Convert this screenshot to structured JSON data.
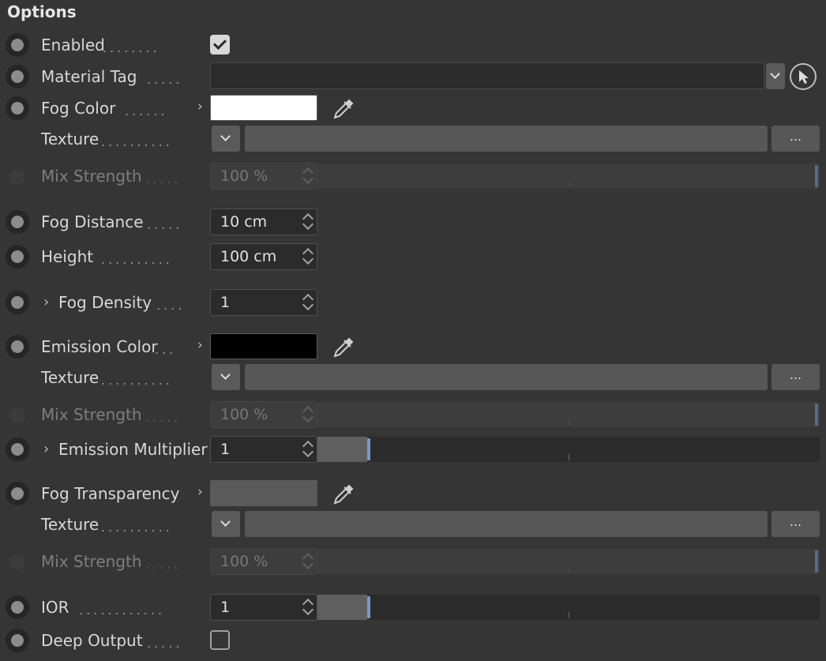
{
  "section": {
    "title": "Options"
  },
  "rows": {
    "enabled": {
      "label": "Enabled",
      "checked": true
    },
    "material_tag": {
      "label": "Material Tag",
      "value": ""
    },
    "fog_color": {
      "label": "Fog Color",
      "color": "#ffffff"
    },
    "fog_color_texture": {
      "label": "Texture",
      "more": "..."
    },
    "fog_color_mix": {
      "label": "Mix Strength",
      "value": "100 %",
      "level": 1.0
    },
    "fog_distance": {
      "label": "Fog Distance",
      "value": "10 cm"
    },
    "height": {
      "label": "Height",
      "value": "100 cm"
    },
    "fog_density": {
      "label": "Fog Density",
      "value": "1"
    },
    "emission_color": {
      "label": "Emission Color",
      "color": "#000000"
    },
    "emission_texture": {
      "label": "Texture",
      "more": "..."
    },
    "emission_mix": {
      "label": "Mix Strength",
      "value": "100 %",
      "level": 1.0
    },
    "emission_multiplier": {
      "label": "Emission Multiplier",
      "value": "1",
      "level": 0.1
    },
    "fog_transparency": {
      "label": "Fog Transparency",
      "color": "#5a5a5a"
    },
    "transparency_texture": {
      "label": "Texture",
      "more": "..."
    },
    "transparency_mix": {
      "label": "Mix Strength",
      "value": "100 %",
      "level": 1.0
    },
    "ior": {
      "label": "IOR",
      "value": "1",
      "level": 0.1
    },
    "deep_output": {
      "label": "Deep Output",
      "checked": false
    }
  },
  "icons": {
    "color_picker": "eyedropper-icon",
    "object_picker": "cursor-pick-icon",
    "expand": "chevron-right-icon",
    "dropdown": "chevron-down-icon"
  },
  "colors": {
    "background": "#353535",
    "slider_handle": "#7b9ac2"
  }
}
